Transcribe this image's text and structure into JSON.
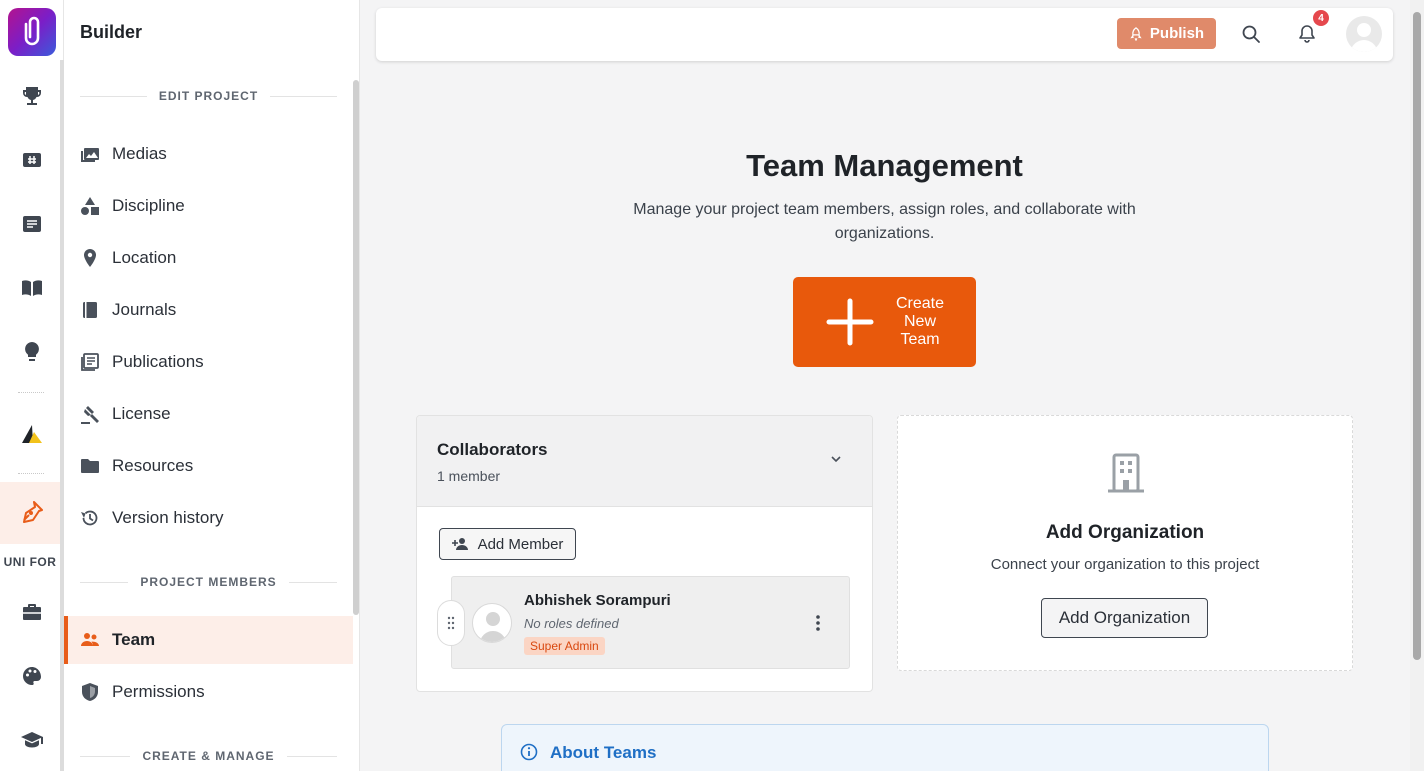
{
  "app": {
    "name": "Builder"
  },
  "rail": {
    "section_label": "UNI FOR"
  },
  "sidebar": {
    "sections": [
      "EDIT PROJECT",
      "PROJECT MEMBERS",
      "CREATE & MANAGE"
    ],
    "edit_items": [
      {
        "label": "Medias",
        "icon": "image-icon"
      },
      {
        "label": "Discipline",
        "icon": "shapes-icon"
      },
      {
        "label": "Location",
        "icon": "location-pin-icon"
      },
      {
        "label": "Journals",
        "icon": "book-icon"
      },
      {
        "label": "Publications",
        "icon": "newspaper-icon"
      },
      {
        "label": "License",
        "icon": "gavel-icon"
      },
      {
        "label": "Resources",
        "icon": "folder-icon"
      },
      {
        "label": "Version history",
        "icon": "history-icon"
      }
    ],
    "member_items": [
      {
        "label": "Team",
        "icon": "people-icon",
        "active": true
      },
      {
        "label": "Permissions",
        "icon": "shield-icon"
      }
    ]
  },
  "topbar": {
    "publish_label": "Publish",
    "notification_count": "4"
  },
  "main": {
    "title": "Team Management",
    "subtitle": "Manage your project team members, assign roles, and collaborate with organizations.",
    "create_team_label": "Create New Team"
  },
  "team_card": {
    "title": "Collaborators",
    "count": "1 member",
    "add_member_label": "Add Member",
    "member": {
      "name": "Abhishek Sorampuri",
      "roles": "No roles defined",
      "badge": "Super Admin"
    }
  },
  "org_card": {
    "title": "Add Organization",
    "subtitle": "Connect your organization to this project",
    "button_label": "Add Organization"
  },
  "about": {
    "title": "About Teams"
  },
  "colors": {
    "accent": "#e8590c",
    "publish": "#e08a6a",
    "active_bg": "#fdeee8",
    "info": "#1f6fc5"
  }
}
